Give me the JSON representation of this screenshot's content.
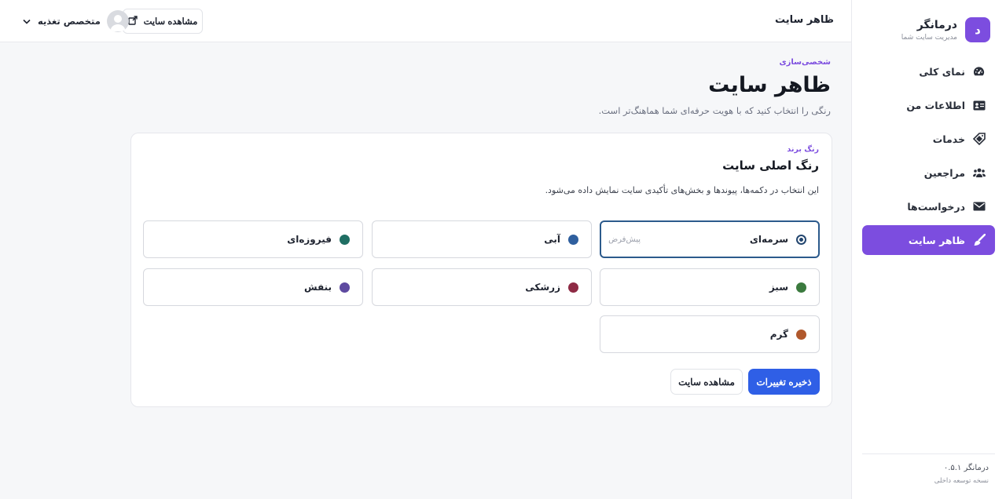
{
  "brand": {
    "logo_letter": "د",
    "name": "درمانگر",
    "subtitle": "مدیریت سایت شما",
    "accent": "#7c4ddf"
  },
  "sidebar": {
    "items": [
      {
        "label": "نمای کلی",
        "icon": "dashboard-gauge-icon",
        "active": false
      },
      {
        "label": "اطلاعات من",
        "icon": "id-card-icon",
        "active": false
      },
      {
        "label": "خدمات",
        "icon": "tag-icon",
        "active": false
      },
      {
        "label": "مراجعین",
        "icon": "users-icon",
        "active": false
      },
      {
        "label": "درخواست‌ها",
        "icon": "envelope-icon",
        "active": false
      },
      {
        "label": "ظاهر سایت",
        "icon": "paint-brush-icon",
        "active": true
      }
    ],
    "footer": {
      "version": "درمانگر ۰.۵.۱",
      "note": "نسخه توسعه داخلی"
    }
  },
  "topbar": {
    "title": "ظاهر سایت",
    "view_site_label": "مشاهده سایت",
    "user_name": "متخصص تغذیه"
  },
  "page": {
    "kicker": "شخصی‌سازی",
    "title": "ظاهر سایت",
    "description": "رنگی را انتخاب کنید که با هویت حرفه‌ای شما هماهنگ‌تر است."
  },
  "card": {
    "kicker": "رنگ برند",
    "title": "رنگ اصلی سایت",
    "description": "این انتخاب در دکمه‌ها، پیوندها و بخش‌های تأکیدی سایت نمایش داده می‌شود.",
    "options": [
      {
        "label": "سرمه‌ای",
        "color": "#23466f",
        "selected": true,
        "default_tag": "پیش‌فرض"
      },
      {
        "label": "آبی",
        "color": "#2f5f9e",
        "selected": false
      },
      {
        "label": "فیروزه‌ای",
        "color": "#1f6e63",
        "selected": false
      },
      {
        "label": "سبز",
        "color": "#3b7a3e",
        "selected": false
      },
      {
        "label": "زرشکی",
        "color": "#8e2a44",
        "selected": false
      },
      {
        "label": "بنفش",
        "color": "#5e4aa0",
        "selected": false
      },
      {
        "label": "گرم",
        "color": "#b0582c",
        "selected": false
      }
    ],
    "save_label": "ذخیره تغییرات",
    "view_label": "مشاهده سایت"
  }
}
